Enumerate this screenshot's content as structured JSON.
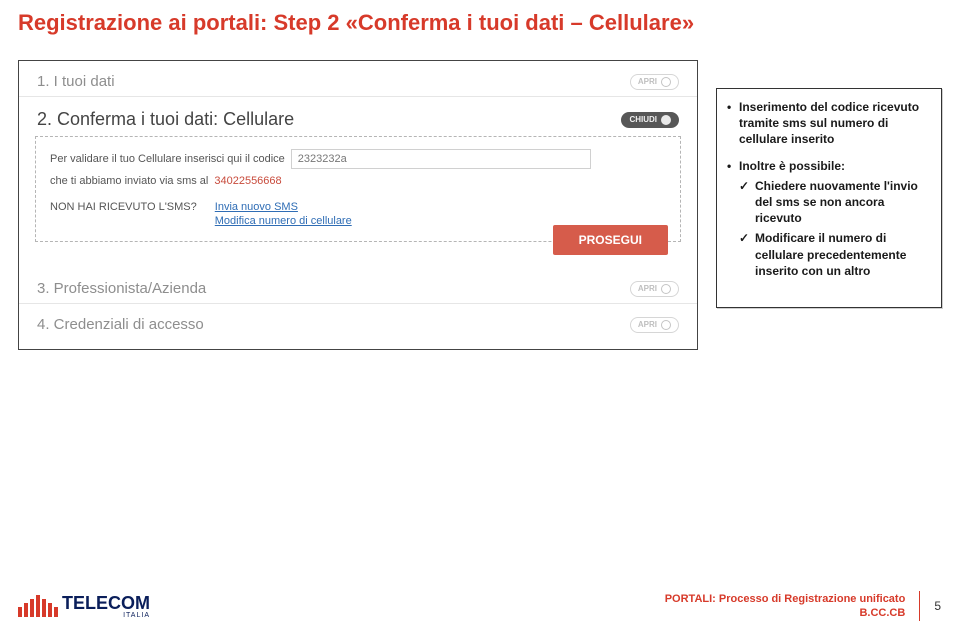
{
  "title": "Registrazione ai portali: Step 2 «Conferma i tuoi dati – Cellulare»",
  "ui": {
    "step1": {
      "label": "1. I tuoi dati",
      "badge": "APRI"
    },
    "step2": {
      "label": "2. Conferma i tuoi dati: Cellulare",
      "badge": "CHIUDI"
    },
    "step3": {
      "label": "3. Professionista/Azienda",
      "badge": "APRI"
    },
    "step4": {
      "label": "4. Credenziali di accesso",
      "badge": "APRI"
    },
    "panel": {
      "instr_pre": "Per validare il tuo Cellulare inserisci qui il codice",
      "code_value": "2323232a",
      "instr_post_pre": "che ti abbiamo inviato via sms al",
      "phone": "34022556668",
      "sms_question": "NON HAI RICEVUTO L'SMS?",
      "link_new_sms": "Invia nuovo SMS",
      "link_mod_num": "Modifica numero di cellulare",
      "prosegui": "PROSEGUI"
    }
  },
  "notes": {
    "n1": "Inserimento del codice ricevuto tramite sms sul numero di cellulare inserito",
    "n2": "Inoltre è possibile:",
    "n2a": "Chiedere nuovamente l'invio del sms se non ancora ricevuto",
    "n2b": "Modificare il numero di cellulare precedentemente inserito con un altro"
  },
  "footer": {
    "brand": "TELECOM",
    "brand_sub": "ITALIA",
    "process": "PORTALI: Processo di Registrazione unificato",
    "code": "B.CC.CB",
    "page": "5"
  }
}
